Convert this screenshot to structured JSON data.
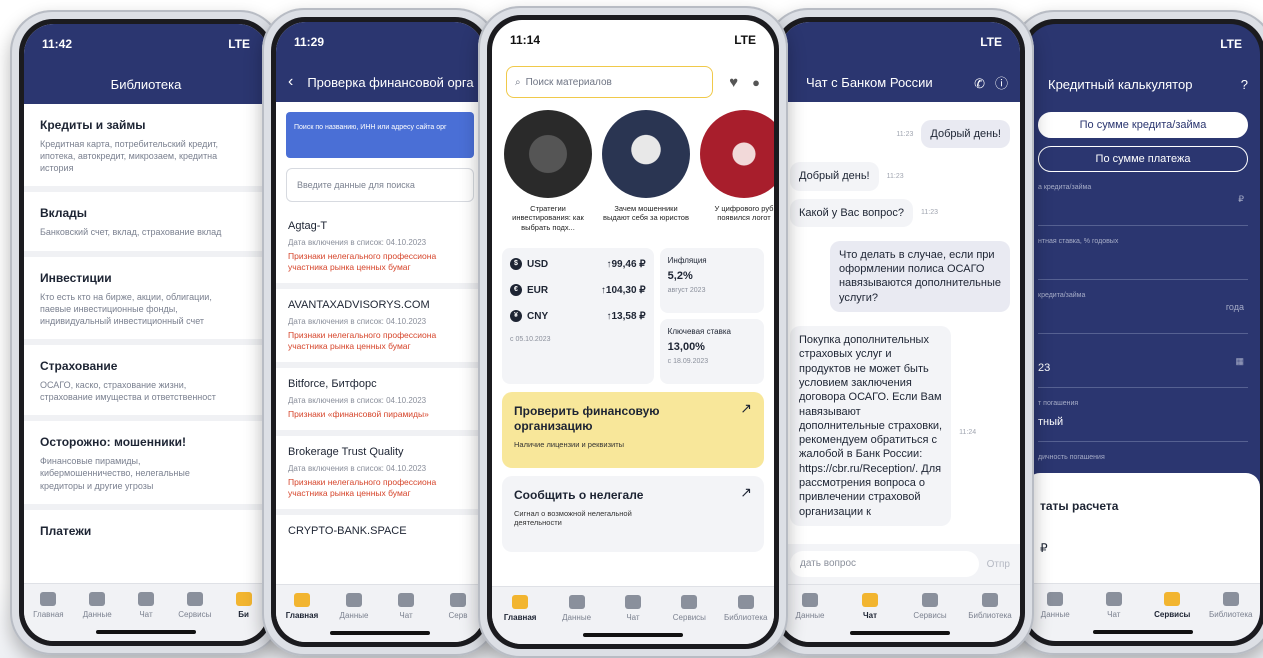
{
  "phone1": {
    "status_time": "11:42",
    "status_net": "LTE",
    "title": "Библиотека",
    "items": [
      {
        "title": "Кредиты и займы",
        "desc": "Кредитная карта, потребительский кредит,\nипотека, автокредит, микрозаем, кредитна\nистория"
      },
      {
        "title": "Вклады",
        "desc": "Банковский счет, вклад, страхование вклад"
      },
      {
        "title": "Инвестиции",
        "desc": "Кто есть кто на бирже, акции, облигации,\nпаевые инвестиционные фонды,\nиндивидуальный инвестиционный счет"
      },
      {
        "title": "Страхование",
        "desc": "ОСАГО, каско, страхование жизни,\nстрахование имущества и ответственност"
      },
      {
        "title": "Осторожно: мошенники!",
        "desc": "Финансовые пирамиды,\nкибермошенничество, нелегальные\nкредиторы и другие угрозы"
      },
      {
        "title": "Платежи",
        "desc": ""
      }
    ],
    "tabs": [
      "Главная",
      "Данные",
      "Чат",
      "Сервисы",
      "Би"
    ]
  },
  "phone2": {
    "status_time": "11:29",
    "title": "Проверка финансовой орга",
    "tip": "Поиск по названию, ИНН или адресу сайта орг",
    "search_placeholder": "Введите данные для поиска",
    "orgs": [
      {
        "name": "Agtag-T",
        "date": "Дата включения в список: 04.10.2023",
        "warn": "Признаки нелегального профессиона\nучастника рынка ценных бумаг"
      },
      {
        "name": "AVANTAXADVISORYS.COM",
        "date": "Дата включения в список: 04.10.2023",
        "warn": "Признаки нелегального профессиона\nучастника рынка ценных бумаг"
      },
      {
        "name": "Bitforce, Битфорс",
        "date": "Дата включения в список: 04.10.2023",
        "warn": "Признаки «финансовой пирамиды»"
      },
      {
        "name": "Brokerage Trust Quality",
        "date": "Дата включения в список: 04.10.2023",
        "warn": "Признаки нелегального профессиона\nучастника рынка ценных бумаг"
      },
      {
        "name": "CRYPTO-BANK.SPACE",
        "date": "",
        "warn": ""
      }
    ],
    "tabs": [
      "Главная",
      "Данные",
      "Чат",
      "Серв"
    ]
  },
  "phone3": {
    "status_time": "11:14",
    "status_net": "LTE",
    "search_placeholder": "Поиск материалов",
    "stories": [
      "Стратегии инвестирования: как выбрать подх...",
      "Зачем мошенники выдают себя за юристов",
      "У цифрового руб появился логот"
    ],
    "currencies": [
      {
        "code": "USD",
        "symbol": "$",
        "value": "↑99,46 ₽"
      },
      {
        "code": "EUR",
        "symbol": "€",
        "value": "↑104,30 ₽"
      },
      {
        "code": "CNY",
        "symbol": "¥",
        "value": "↑13,58 ₽"
      }
    ],
    "currency_date": "с 05.10.2023",
    "inflation": {
      "label": "Инфляция",
      "value": "5,2%",
      "date": "август 2023"
    },
    "key_rate": {
      "label": "Ключевая ставка",
      "value": "13,00%",
      "date": "с 18.09.2023"
    },
    "banner1": {
      "title": "Проверить финансовую организацию",
      "sub": "Наличие лицензии и реквизиты"
    },
    "banner2": {
      "title": "Сообщить о нелегале",
      "sub": "Сигнал о возможной нелегальной деятельности"
    },
    "tabs": [
      "Главная",
      "Данные",
      "Чат",
      "Сервисы",
      "Библиотека"
    ],
    "colors": {
      "accent": "#f2b530",
      "navy": "#2b3670"
    }
  },
  "phone4": {
    "status_net": "LTE",
    "title": "Чат с Банком России",
    "messages": [
      {
        "dir": "out",
        "text": "Добрый день!",
        "time": "11:23"
      },
      {
        "dir": "in",
        "text": "Добрый день!",
        "time": "11:23"
      },
      {
        "dir": "in",
        "text": "Какой у Вас вопрос?",
        "time": "11:23"
      },
      {
        "dir": "out",
        "text": "Что делать в случае, если при\nоформлении полиса ОСАГО\nнавязываются дополнительные\nуслуги?",
        "time": ""
      },
      {
        "dir": "in",
        "text": "Покупка дополнительных\nстраховых услуг и\nпродуктов не может быть\nусловием заключения\nдоговора ОСАГО. Если Вам\nнавязывают\nдополнительные страховки,\nрекомендуем обратиться с\nжалобой в Банк России:\nhttps://cbr.ru/Reception/. Для\nрассмотрения вопроса о\nпривлечении страховой\nорганизации к",
        "time": "11:24"
      }
    ],
    "input_placeholder": "дать вопрос",
    "send_label": "Отпр",
    "tabs": [
      "Данные",
      "Чат",
      "Сервисы",
      "Библиотека"
    ]
  },
  "phone5": {
    "status_net": "LTE",
    "title": "Кредитный калькулятор",
    "mode_a": "По сумме кредита/займа",
    "mode_b": "По сумме платежа",
    "fields": [
      {
        "label": "а кредита/займа",
        "suffix": "₽",
        "value": ""
      },
      {
        "label": "нтная ставка, % годовых",
        "suffix": "",
        "value": ""
      },
      {
        "label": "кредита/займа",
        "suffix": "года",
        "value": ""
      },
      {
        "label": "",
        "suffix": "",
        "value": "23"
      },
      {
        "label": "т погашения",
        "suffix": "",
        "value": "тный"
      },
      {
        "label": "дичность погашения",
        "suffix": "",
        "value": ""
      }
    ],
    "results_title": "таты расчета",
    "results_value": "₽",
    "tabs": [
      "Данные",
      "Чат",
      "Сервисы",
      "Библиотека"
    ]
  }
}
